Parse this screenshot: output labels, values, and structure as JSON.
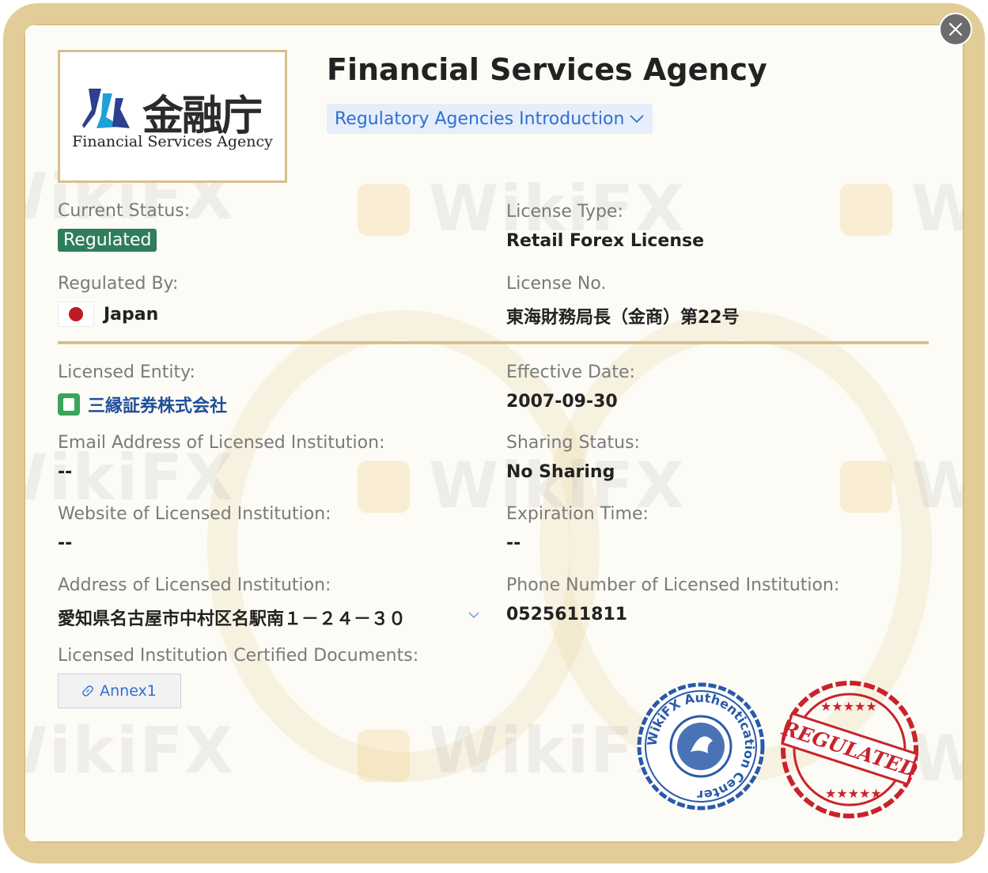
{
  "header": {
    "title": "Financial Services Agency",
    "intro_link": "Regulatory Agencies Introduction"
  },
  "logo": {
    "cjk": "金融庁",
    "english": "Financial Services Agency"
  },
  "status": {
    "label": "Current Status:",
    "value": "Regulated"
  },
  "license_type": {
    "label": "License Type:",
    "value": "Retail Forex License"
  },
  "regulated_by": {
    "label": "Regulated By:",
    "value": "Japan"
  },
  "license_no": {
    "label": "License No.",
    "value": "東海財務局長（金商）第22号"
  },
  "entity": {
    "label": "Licensed Entity:",
    "value": "三縁証券株式会社"
  },
  "effective_date": {
    "label": "Effective Date:",
    "value": "2007-09-30"
  },
  "email": {
    "label": "Email Address of Licensed Institution:",
    "value": "--"
  },
  "sharing": {
    "label": "Sharing Status:",
    "value": "No Sharing"
  },
  "website": {
    "label": "Website of Licensed Institution:",
    "value": "--"
  },
  "expiration": {
    "label": "Expiration Time:",
    "value": "--"
  },
  "address": {
    "label": "Address of Licensed Institution:",
    "value": "愛知県名古屋市中村区名駅南１－２４－３０"
  },
  "phone": {
    "label": "Phone Number of Licensed Institution:",
    "value": "0525611811"
  },
  "documents": {
    "label": "Licensed Institution Certified Documents:",
    "annex": "Annex1"
  },
  "seals": {
    "blue_text": "WikiFX Authentication Center",
    "red_text": "REGULATED"
  },
  "watermark": "WikiFX",
  "colors": {
    "accent_blue": "#2f6fd0",
    "regulated_green": "#2e7d5b",
    "border_gold": "#e2cd99",
    "seal_red": "#c8232c",
    "seal_blue": "#2a5aa8"
  }
}
